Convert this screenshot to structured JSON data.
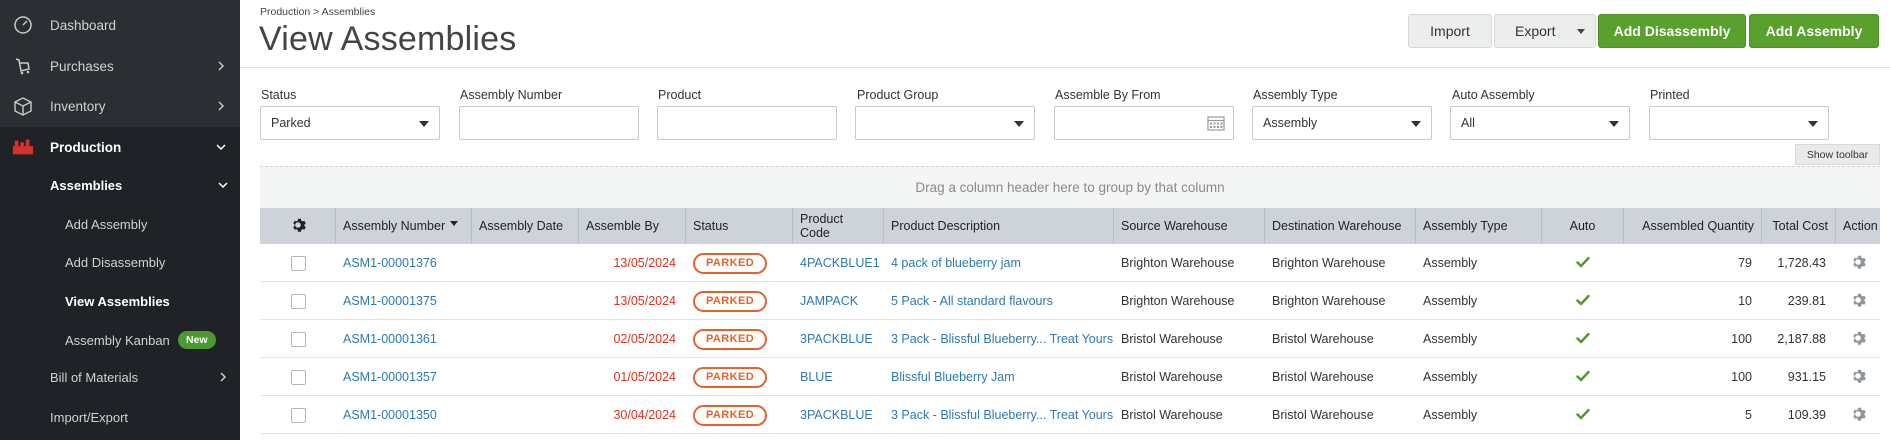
{
  "sidebar": {
    "items": [
      {
        "label": "Dashboard",
        "icon": "dashboard-icon"
      },
      {
        "label": "Purchases",
        "icon": "purchases-icon"
      },
      {
        "label": "Inventory",
        "icon": "inventory-icon"
      },
      {
        "label": "Production",
        "icon": "production-icon"
      }
    ],
    "sub": {
      "assemblies": "Assemblies",
      "add_assembly": "Add Assembly",
      "add_disassembly": "Add Disassembly",
      "view_assemblies": "View Assemblies",
      "assembly_kanban": "Assembly Kanban",
      "kanban_badge": "New",
      "bill_of_materials": "Bill of Materials",
      "import_export": "Import/Export"
    }
  },
  "header": {
    "breadcrumb": "Production > Assemblies",
    "title": "View Assemblies",
    "buttons": {
      "import": "Import",
      "export": "Export",
      "add_disassembly": "Add Disassembly",
      "add_assembly": "Add Assembly"
    }
  },
  "filters": {
    "status": {
      "label": "Status",
      "value": "Parked"
    },
    "assembly_number": {
      "label": "Assembly Number",
      "value": ""
    },
    "product": {
      "label": "Product",
      "value": ""
    },
    "product_group": {
      "label": "Product Group",
      "value": ""
    },
    "assemble_by_from": {
      "label": "Assemble By From",
      "value": ""
    },
    "assembly_type": {
      "label": "Assembly Type",
      "value": "Assembly"
    },
    "auto_assembly": {
      "label": "Auto Assembly",
      "value": "All"
    },
    "printed": {
      "label": "Printed",
      "value": ""
    }
  },
  "toolbar": {
    "show_toolbar": "Show toolbar",
    "group_hint": "Drag a column header here to group by that column"
  },
  "grid": {
    "columns": {
      "assembly_number": "Assembly Number",
      "assembly_date": "Assembly Date",
      "assemble_by": "Assemble By",
      "status": "Status",
      "product_code_1": "Product",
      "product_code_2": "Code",
      "product_description": "Product Description",
      "source_warehouse": "Source Warehouse",
      "destination_warehouse": "Destination Warehouse",
      "assembly_type": "Assembly Type",
      "auto": "Auto",
      "assembled_quantity": "Assembled Quantity",
      "total_cost": "Total Cost",
      "action": "Action"
    },
    "rows": [
      {
        "number": "ASM1-00001376",
        "date": "",
        "assemble_by": "13/05/2024",
        "status": "PARKED",
        "code": "4PACKBLUE1",
        "description": "4 pack of blueberry jam",
        "source": "Brighton Warehouse",
        "destination": "Brighton Warehouse",
        "type": "Assembly",
        "qty": "79",
        "cost": "1,728.43"
      },
      {
        "number": "ASM1-00001375",
        "date": "",
        "assemble_by": "13/05/2024",
        "status": "PARKED",
        "code": "JAMPACK",
        "description": "5 Pack - All standard flavours",
        "source": "Brighton Warehouse",
        "destination": "Brighton Warehouse",
        "type": "Assembly",
        "qty": "10",
        "cost": "239.81"
      },
      {
        "number": "ASM1-00001361",
        "date": "",
        "assemble_by": "02/05/2024",
        "status": "PARKED",
        "code": "3PACKBLUE",
        "description": "3 Pack - Blissful Blueberry... Treat Yours",
        "source": "Bristol Warehouse",
        "destination": "Bristol Warehouse",
        "type": "Assembly",
        "qty": "100",
        "cost": "2,187.88"
      },
      {
        "number": "ASM1-00001357",
        "date": "",
        "assemble_by": "01/05/2024",
        "status": "PARKED",
        "code": "BLUE",
        "description": "Blissful Blueberry Jam",
        "source": "Bristol Warehouse",
        "destination": "Bristol Warehouse",
        "type": "Assembly",
        "qty": "100",
        "cost": "931.15"
      },
      {
        "number": "ASM1-00001350",
        "date": "",
        "assemble_by": "30/04/2024",
        "status": "PARKED",
        "code": "3PACKBLUE",
        "description": "3 Pack - Blissful Blueberry... Treat Yours",
        "source": "Bristol Warehouse",
        "destination": "Bristol Warehouse",
        "type": "Assembly",
        "qty": "5",
        "cost": "109.39"
      }
    ]
  },
  "colors": {
    "accent_green": "#5aa02c",
    "link_blue": "#2c79b5",
    "date_red": "#e0301e",
    "parked_orange": "#e6622d",
    "sidebar_bg": "#2b2f33"
  }
}
